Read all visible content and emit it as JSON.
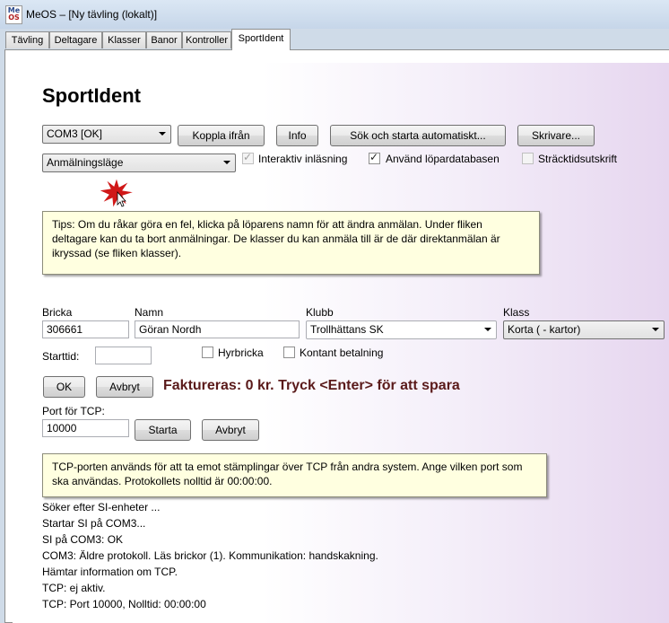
{
  "window": {
    "title": "MeOS – [Ny tävling (lokalt)]",
    "icon": [
      "Me",
      "OS"
    ]
  },
  "tabs": [
    {
      "label": "Tävling"
    },
    {
      "label": "Deltagare"
    },
    {
      "label": "Klasser"
    },
    {
      "label": "Banor"
    },
    {
      "label": "Kontroller"
    },
    {
      "label": "SportIdent",
      "active": true
    }
  ],
  "page": {
    "title": "SportIdent"
  },
  "toolbar": {
    "port": "COM3 [OK]",
    "disconnect": "Koppla ifrån",
    "info": "Info",
    "search_start": "Sök och starta automatiskt...",
    "printer": "Skrivare...",
    "mode": "Anmälningsläge"
  },
  "options": {
    "interactive": {
      "label": "Interaktiv inläsning",
      "checked": true,
      "enabled": false
    },
    "runner_db": {
      "label": "Använd löpardatabasen",
      "checked": true,
      "enabled": true
    },
    "split_print": {
      "label": "Sträcktidsutskrift",
      "checked": false,
      "enabled": false
    }
  },
  "tip1": "Tips: Om du råkar göra en fel, klicka på löparens namn för att ändra anmälan. Under fliken deltagare kan du ta bort anmälningar. De klasser du kan anmäla till är de där direktanmälan är ikryssad (se fliken klasser).",
  "form": {
    "card_label": "Bricka",
    "card_value": "306661",
    "name_label": "Namn",
    "name_value": "Göran Nordh",
    "club_label": "Klubb",
    "club_value": "Trollhättans SK",
    "class_label": "Klass",
    "class_value": "Korta ( - kartor)",
    "start_label": "Starttid:",
    "start_value": "",
    "rent_label": "Hyrbricka",
    "rent_checked": false,
    "cash_label": "Kontant betalning",
    "cash_checked": false,
    "ok": "OK",
    "cancel": "Avbryt",
    "invoice_text": "Faktureras: 0 kr. Tryck <Enter> för att spara"
  },
  "tcp": {
    "port_label": "Port för TCP:",
    "port_value": "10000",
    "start": "Starta",
    "cancel": "Avbryt"
  },
  "tip2": "TCP-porten används för att ta emot stämplingar över TCP från andra system. Ange vilken port som ska användas. Protokollets nolltid är 00:00:00.",
  "log": [
    "Söker efter SI-enheter ...",
    "Startar SI på COM3...",
    "SI på COM3: OK",
    "COM3: Äldre protokoll. Läs brickor (1). Kommunikation: handskakning.",
    "Hämtar information om TCP.",
    "TCP: ej aktiv.",
    "TCP: Port 10000, Nolltid: 00:00:00"
  ],
  "colors": {
    "tip_bg": "#ffffe0",
    "invoice_text": "#5a1a1a",
    "accent_gradient": "#e6d6ef"
  }
}
